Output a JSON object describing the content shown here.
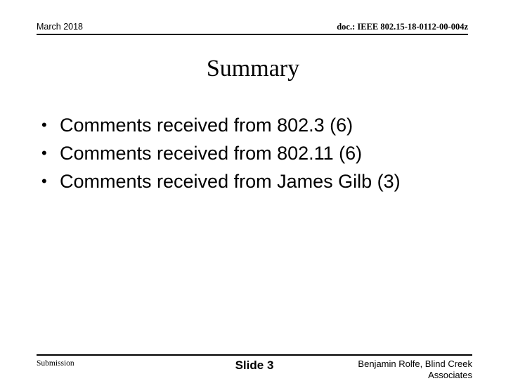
{
  "slide": {
    "header": {
      "left": "March 2018",
      "right": "doc.: IEEE 802.15-18-0112-00-004z"
    },
    "title": "Summary",
    "bullets": [
      {
        "marker": "•",
        "text": "Comments received from 802.3 (6)"
      },
      {
        "marker": "•",
        "text": "Comments received from 802.11 (6)"
      },
      {
        "marker": "•",
        "text": "Comments received from James Gilb (3)"
      }
    ],
    "footer": {
      "left": "Submission",
      "center": "Slide 3",
      "right": "Benjamin Rolfe, Blind Creek Associates"
    },
    "colors": {
      "background": "#ffffff",
      "text": "#000000",
      "rule": "#000000"
    }
  }
}
